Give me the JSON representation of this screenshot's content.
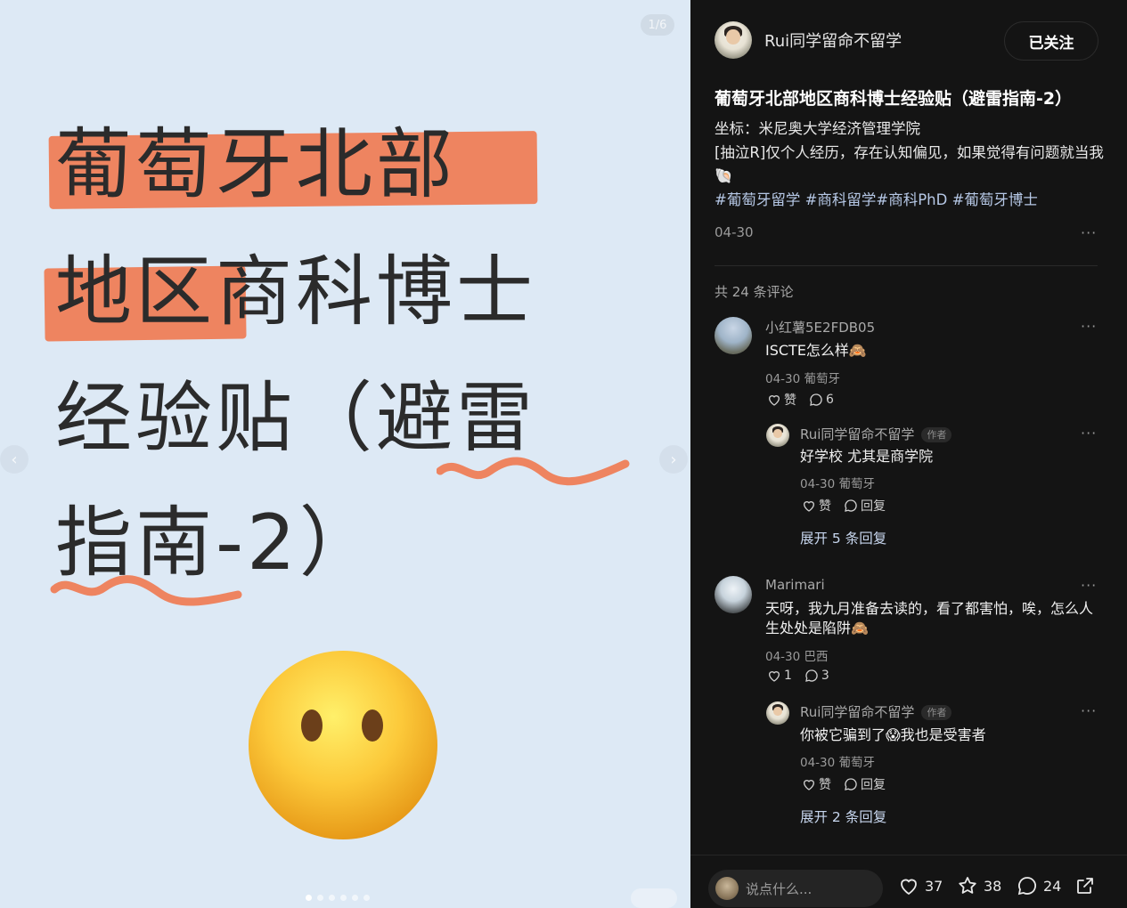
{
  "media": {
    "counter": "1/6",
    "headline_lines": [
      "葡萄牙北部",
      "地区商科博士",
      "经验贴（避雷",
      "指南-2）"
    ],
    "slide_count": 6,
    "active_slide": 0
  },
  "author": {
    "name": "Rui同学留命不留学",
    "follow_label": "已关注"
  },
  "note": {
    "title": "葡萄牙北部地区商科博士经验贴（避雷指南-2）",
    "desc_line1": "坐标：米尼奥大学经济管理学院",
    "desc_line2": "[抽泣R]仅个人经历，存在认知偏见，如果觉得有问题就当我",
    "desc_emoji": "🐚",
    "tags": "#葡萄牙留学 #商科留学#商科PhD #葡萄牙博士",
    "date": "04-30",
    "more": "···"
  },
  "comments_header": "共 24 条评论",
  "comments": [
    {
      "name": "小红薯5E2FDB05",
      "text": "ISCTE怎么样🙈",
      "meta": "04-30 葡萄牙",
      "like": "赞",
      "reply_count": "6",
      "reply": {
        "name": "Rui同学留命不留学",
        "author_tag": "作者",
        "text": "好学校 尤其是商学院",
        "meta": "04-30 葡萄牙",
        "like": "赞",
        "reply_label": "回复"
      },
      "expand": "展开 5 条回复"
    },
    {
      "name": "Marimari",
      "text": "天呀，我九月准备去读的，看了都害怕，唉，怎么人生处处是陷阱🙈",
      "meta": "04-30 巴西",
      "like": "1",
      "reply_count": "3",
      "reply": {
        "name": "Rui同学留命不留学",
        "author_tag": "作者",
        "text": "你被它骗到了😱我也是受害者",
        "meta": "04-30 葡萄牙",
        "like": "赞",
        "reply_label": "回复"
      },
      "expand": "展开 2 条回复"
    }
  ],
  "bottom": {
    "placeholder": "说点什么...",
    "likes": "37",
    "collects": "38",
    "comments": "24"
  },
  "colors": {
    "highlight": "#ee8460",
    "panel_bg": "#141414",
    "image_bg": "#dde9f5",
    "link": "#b6c8e6"
  },
  "icons": [
    "heart-icon",
    "star-icon",
    "comment-bubble-icon",
    "share-icon",
    "chevron-left-icon",
    "chevron-right-icon"
  ]
}
